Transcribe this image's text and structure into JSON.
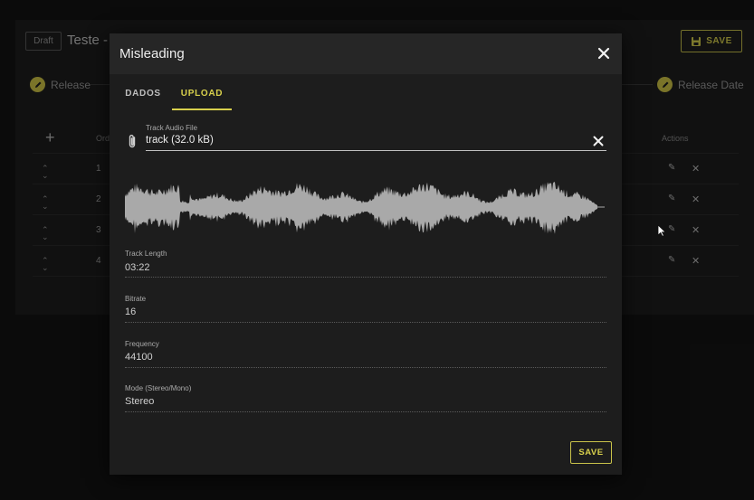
{
  "background": {
    "draft_badge": "Draft",
    "title": "Teste - ",
    "save_label": "SAVE",
    "steps": {
      "release": "Release",
      "release_date": "Release Date"
    },
    "table": {
      "order_header": "Ord",
      "actions_header": "Actions",
      "rows": [
        "1",
        "2",
        "3",
        "4"
      ]
    }
  },
  "modal": {
    "title": "Misleading",
    "tabs": [
      {
        "label": "DADOS"
      },
      {
        "label": "UPLOAD"
      }
    ],
    "active_tab": "UPLOAD",
    "file": {
      "label": "Track Audio File",
      "value": "track (32.0 kB)"
    },
    "fields": [
      {
        "label": "Track Length",
        "value": "03:22"
      },
      {
        "label": "Bitrate",
        "value": "16"
      },
      {
        "label": "Frequency",
        "value": "44100"
      },
      {
        "label": "Mode (Stereo/Mono)",
        "value": "Stereo"
      }
    ],
    "save_label": "SAVE"
  },
  "colors": {
    "accent": "#d8d04c",
    "waveform": "#a9a9a9",
    "modal_bg": "#1d1d1d",
    "page_bg": "#141414"
  }
}
